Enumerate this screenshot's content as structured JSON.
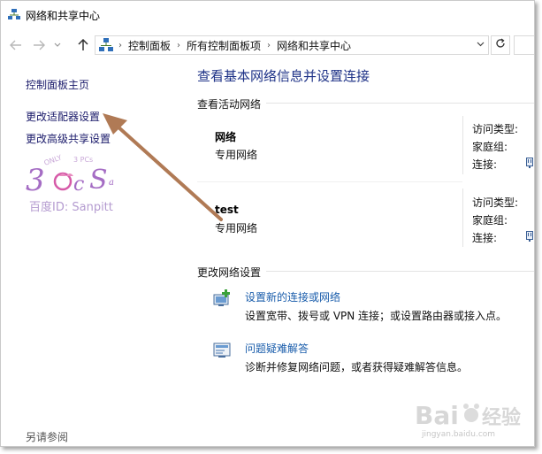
{
  "window": {
    "title": "网络和共享中心"
  },
  "addressbar": {
    "back_icon": "arrow-left-icon",
    "forward_icon": "arrow-right-icon",
    "dropdown_icon": "chevron-down-icon",
    "up_icon": "arrow-up-icon",
    "breadcrumbs": [
      "控制面板",
      "所有控制面板项",
      "网络和共享中心"
    ],
    "refresh_icon": "refresh-icon"
  },
  "sidebar": {
    "items": [
      {
        "label": "控制面板主页"
      },
      {
        "label": "更改适配器设置"
      },
      {
        "label": "更改高级共享设置"
      }
    ],
    "footer": "另请参阅"
  },
  "watermark": {
    "text": "百度ID: Sanpitt"
  },
  "main": {
    "title": "查看基本网络信息并设置连接",
    "active_networks_heading": "查看活动网络",
    "networks": [
      {
        "name": "网络",
        "type": "专用网络",
        "access_label": "访问类型:",
        "homegroup_label": "家庭组:",
        "connection_label": "连接:"
      },
      {
        "name": "test",
        "type": "专用网络",
        "access_label": "访问类型:",
        "homegroup_label": "家庭组:",
        "connection_label": "连接:"
      }
    ],
    "change_settings_heading": "更改网络设置",
    "tasks": [
      {
        "link": "设置新的连接或网络",
        "desc": "设置宽带、拨号或 VPN 连接；或设置路由器或接入点。",
        "icon": "new-connection-icon"
      },
      {
        "link": "问题疑难解答",
        "desc": "诊断并修复网络问题，或者获得疑难解答信息。",
        "icon": "troubleshoot-icon"
      }
    ]
  },
  "colors": {
    "link_blue": "#1a5dab",
    "title_blue": "#1e3287",
    "annotation_arrow": "#b07a55"
  }
}
